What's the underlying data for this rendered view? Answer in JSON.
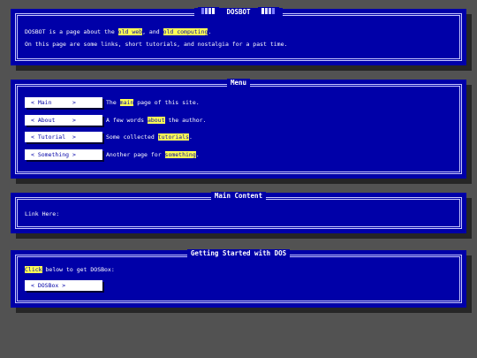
{
  "panels": {
    "dosbot": {
      "title": "DOSBOT",
      "line1": {
        "pre": "DOSBOT is a page about the ",
        "h1": "old web",
        "mid": ", and ",
        "h2": "old computing",
        "post": "."
      },
      "line2": "On this page are some links, short tutorials, and nostalgia for a past time."
    },
    "menu": {
      "title": "Menu",
      "items": [
        {
          "button": "< Main      >",
          "pre": "The ",
          "hl": "main",
          "post": " page of this site."
        },
        {
          "button": "< About     >",
          "pre": "A few words ",
          "hl": "about",
          "post": " the author."
        },
        {
          "button": "< Tutorial  >",
          "pre": "Some collected ",
          "hl": "tutorials",
          "post": "."
        },
        {
          "button": "< Something >",
          "pre": "Another page for ",
          "hl": "something",
          "post": "."
        }
      ]
    },
    "main_content": {
      "title": "Main Content",
      "text": "Link Here:"
    },
    "getting_started": {
      "title": "Getting Started with DOS",
      "hl": "Click",
      "post": " below to get DOSBox:",
      "button": "< DOSBox >"
    }
  },
  "colors": {
    "background": "#525252",
    "panel": "#0000a8",
    "highlight": "#ffff55",
    "button": "#ffffff"
  }
}
